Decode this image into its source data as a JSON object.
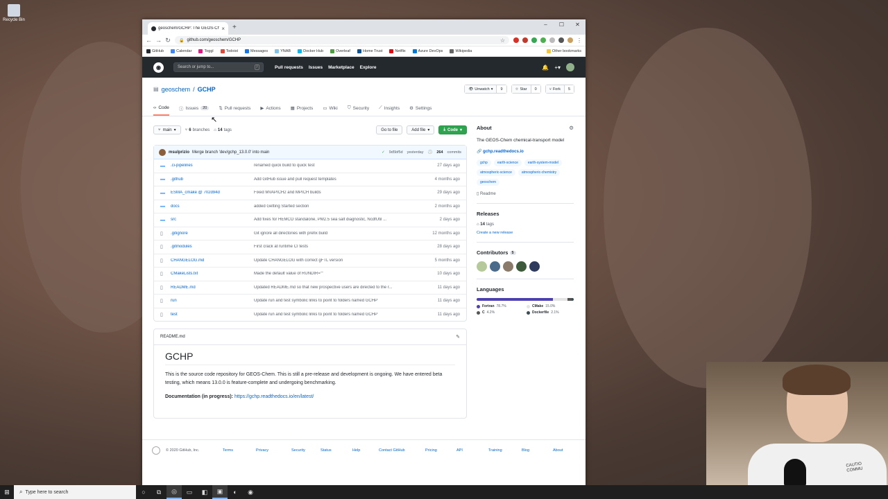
{
  "desktop": {
    "icon_label": "Recycle Bin"
  },
  "taskbar": {
    "search_placeholder": "Type here to search"
  },
  "browser": {
    "tab_title": "geoschem/GCHP: The GEOS-Che",
    "url": "github.com/geoschem/GCHP",
    "bookmarks": [
      "GitHub",
      "Calendar",
      "Toggl",
      "Todoist",
      "Messages",
      "YNAB",
      "Docker Hub",
      "Overleaf",
      "Home Trust",
      "Netflix",
      "Azure DevOps",
      "Wikipedia"
    ],
    "other_bookmarks": "Other bookmarks"
  },
  "gh": {
    "search_placeholder": "Search or jump to...",
    "nav": [
      "Pull requests",
      "Issues",
      "Marketplace",
      "Explore"
    ]
  },
  "repo": {
    "owner": "geoschem",
    "name": "GCHP",
    "unwatch": "Unwatch",
    "watch_count": "9",
    "star": "Star",
    "star_count": "0",
    "fork": "Fork",
    "fork_count": "5",
    "tabs": [
      {
        "label": "Code"
      },
      {
        "label": "Issues",
        "count": "20"
      },
      {
        "label": "Pull requests"
      },
      {
        "label": "Actions"
      },
      {
        "label": "Projects"
      },
      {
        "label": "Wiki"
      },
      {
        "label": "Security"
      },
      {
        "label": "Insights"
      },
      {
        "label": "Settings"
      }
    ],
    "branch": "main",
    "branches_count": "6",
    "branches_label": "branches",
    "tags_count": "14",
    "tags_label": "tags",
    "go_to_file": "Go to file",
    "add_file": "Add file",
    "code_btn": "Code",
    "commit": {
      "author": "msulprizio",
      "message": "Merge branch 'dev/gchp_13.0.0' into main",
      "sha": "9d5bf5d",
      "time": "yesterday",
      "commits_count": "264",
      "commits_label": "commits"
    },
    "files": [
      {
        "name": ".ci-pipelines",
        "msg": "renamed quick build to quick test",
        "age": "27 days ago",
        "type": "dir"
      },
      {
        "name": ".github",
        "msg": "Add GitHub issue and pull request templates",
        "age": "4 months ago",
        "type": "dir"
      },
      {
        "name": "ESMA_cmake @ 702d94d",
        "msg": "Fixed MVAPICH2 and MPICH builds",
        "age": "29 days ago",
        "type": "dir"
      },
      {
        "name": "docs",
        "msg": "added Getting Started section",
        "age": "2 months ago",
        "type": "dir"
      },
      {
        "name": "src",
        "msg": "Add fixes for HEMCO standalone, PM2.5 sea salt diagnostic, NcdfUtil ...",
        "age": "2 days ago",
        "type": "dir"
      },
      {
        "name": ".gitignore",
        "msg": "Git ignore all directories with prefix build",
        "age": "12 months ago",
        "type": "file"
      },
      {
        "name": ".gitmodules",
        "msg": "First crack at runtime CI tests",
        "age": "28 days ago",
        "type": "file"
      },
      {
        "name": "CHANGELOG.md",
        "msg": "Update CHANGELOG with correct gFTL version",
        "age": "5 months ago",
        "type": "file"
      },
      {
        "name": "CMakeLists.txt",
        "msg": "Made the default value of RUNDIR=\"\"",
        "age": "10 days ago",
        "type": "file"
      },
      {
        "name": "README.md",
        "msg": "Updated README.md so that new prospective users are directed to the r...",
        "age": "11 days ago",
        "type": "file"
      },
      {
        "name": "run",
        "msg": "Update run and test symbolic links to point to folders named GCHP",
        "age": "11 days ago",
        "type": "file"
      },
      {
        "name": "test",
        "msg": "Update run and test symbolic links to point to folders named GCHP",
        "age": "11 days ago",
        "type": "file"
      }
    ],
    "readme": {
      "filename": "README.md",
      "title": "GCHP",
      "paragraph": "This is the source code repository for GEOS-Chem. This is still a pre-release and development is ongoing. We have entered beta testing, which means 13.0.0 is feature-complete and undergoing benchmarking.",
      "doc_label": "Documentation (in progress):",
      "doc_link": "https://gchp.readthedocs.io/en/latest/"
    }
  },
  "sidebar": {
    "about_title": "About",
    "description": "The GEOS-Chem chemical-transport model",
    "website": "gchp.readthedocs.io",
    "topics": [
      "gchp",
      "earth-science",
      "earth-system-model",
      "atmospheric-science",
      "atmospheric-chemistry",
      "geoschem"
    ],
    "readme_label": "Readme",
    "releases_title": "Releases",
    "releases_count": "14",
    "releases_tags": "tags",
    "create_release": "Create a new release",
    "contributors_title": "Contributors",
    "contributors_count": "5",
    "languages_title": "Languages",
    "languages": [
      {
        "name": "Fortran",
        "pct": "78.7%",
        "share": 78.7,
        "color": "#4d41b1"
      },
      {
        "name": "CMake",
        "pct": "15.0%",
        "share": 15.0,
        "color": "#e5e5e5"
      },
      {
        "name": "C",
        "pct": "4.2%",
        "share": 4.2,
        "color": "#555555"
      },
      {
        "name": "Dockerfile",
        "pct": "2.1%",
        "share": 2.1,
        "color": "#384d54"
      }
    ]
  },
  "footer": {
    "copyright": "© 2020 GitHub, Inc.",
    "links": [
      "Terms",
      "Privacy",
      "Security",
      "Status",
      "Help",
      "Contact GitHub",
      "Pricing",
      "API",
      "Training",
      "Blog",
      "About"
    ]
  },
  "webcam": {
    "shirt_text_1": "CAUTIO",
    "shirt_text_2": "COMMU"
  }
}
